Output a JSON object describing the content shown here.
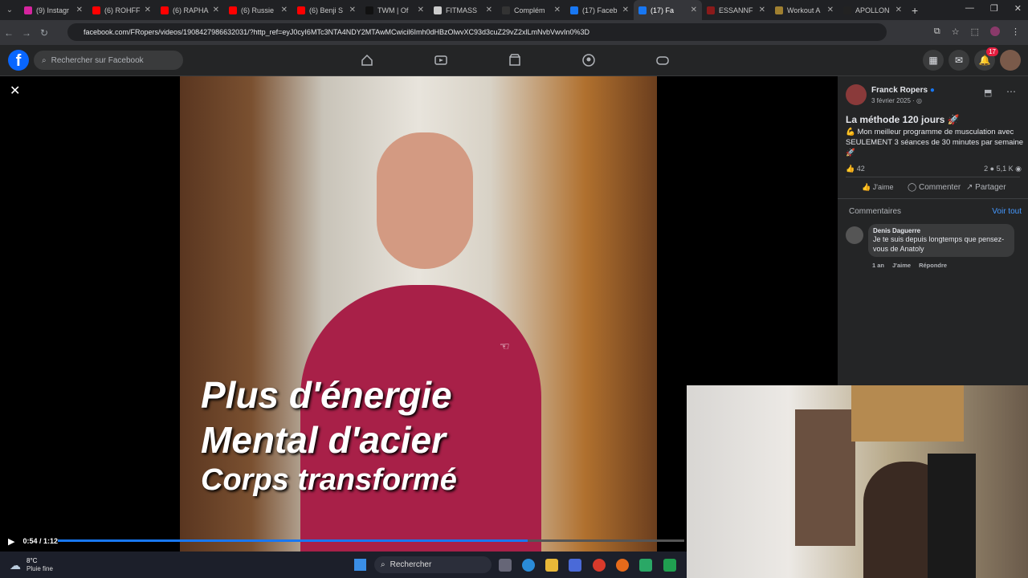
{
  "browser": {
    "tabs": [
      {
        "label": "(9) Instagr",
        "color": "#d6249f"
      },
      {
        "label": "(6) ROHFF",
        "color": "#ff0000"
      },
      {
        "label": "(6) RAPHA",
        "color": "#ff0000"
      },
      {
        "label": "(6) Russie",
        "color": "#ff0000"
      },
      {
        "label": "(6) Benji S",
        "color": "#ff0000"
      },
      {
        "label": "TWM | Of",
        "color": "#111111"
      },
      {
        "label": "FITMASS",
        "color": "#cccccc"
      },
      {
        "label": "Complém",
        "color": "#333333"
      },
      {
        "label": "(17) Faceb",
        "color": "#1877f2"
      },
      {
        "label": "(17) Fa",
        "color": "#1877f2"
      },
      {
        "label": "ESSANNF",
        "color": "#8a1a1a"
      },
      {
        "label": "Workout A",
        "color": "#a08030"
      },
      {
        "label": "APOLLON",
        "color": "#222222"
      }
    ],
    "url": "facebook.com/FRopers/videos/1908427986632031/?http_ref=eyJ0cyI6MTc3NTA4NDY2MTAwMCwicil6Imh0dHBzOlwvXC93d3cuZ29vZ2xlLmNvbVwvIn0%3D"
  },
  "facebook": {
    "search_placeholder": "Rechercher sur Facebook",
    "notifications_count": "17"
  },
  "video": {
    "caption_lines": [
      "Plus d'énergie",
      "Mental d'acier",
      "Corps transformé"
    ],
    "time_label": "0:54 / 1:12",
    "progress": 0.75
  },
  "post": {
    "author": "Franck Ropers",
    "date": "3 février 2025 · ",
    "title": "La méthode 120 jours 🚀",
    "body": "💪 Mon meilleur programme de musculation avec SEULEMENT 3 séances de 30 minutes par semaine 🚀",
    "reactions": "42",
    "comments_count": "2",
    "views": "5,1 K",
    "like_label": "J'aime",
    "comment_label": "Commenter",
    "share_label": "Partager",
    "comments_header": "Commentaires",
    "see_all": "Voir tout",
    "comment": {
      "author": "Denis Daguerre",
      "text": "Je te suis depuis longtemps que pensez-vous de Anatoly",
      "age": "1 an",
      "like": "J'aime",
      "reply": "Répondre"
    }
  },
  "taskbar": {
    "temp": "8°C",
    "weather": "Pluie fine",
    "search_label": "Rechercher"
  }
}
